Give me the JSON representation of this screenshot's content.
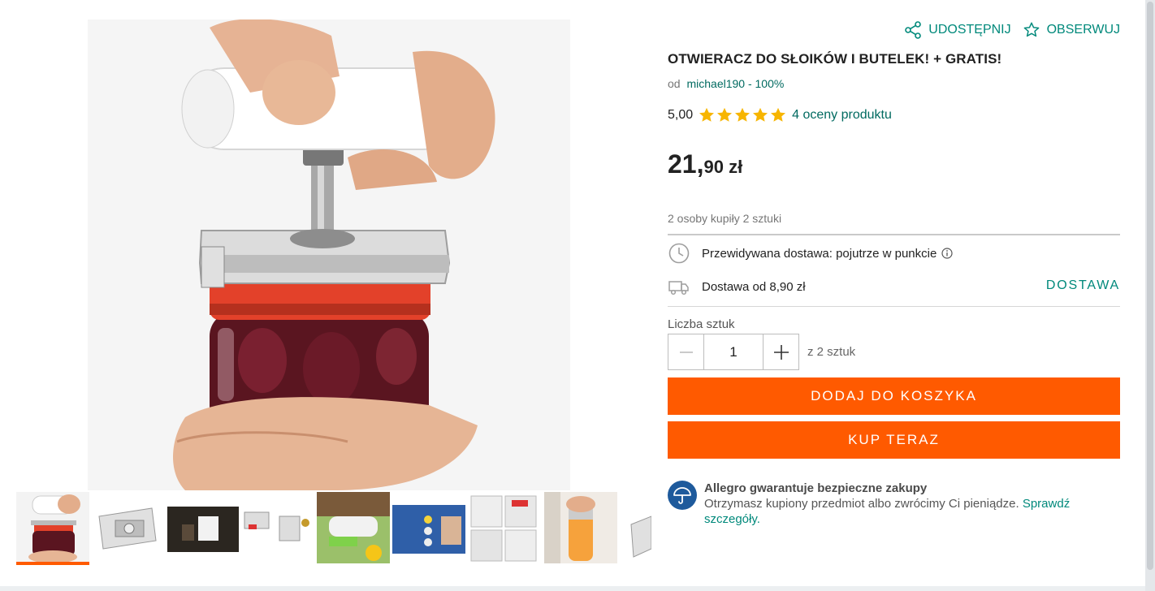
{
  "actions": {
    "share": "UDOSTĘPNIJ",
    "follow": "OBSERWUJ"
  },
  "product": {
    "title": "OTWIERACZ DO SŁOIKÓW I BUTELEK! + GRATIS!",
    "seller_prefix": "od",
    "seller": "michael190 - 100%",
    "rating_value": "5,00",
    "rating_stars": 5,
    "rating_max": 5,
    "rating_link": "4 oceny produktu",
    "price_int": "21,",
    "price_dec": "90 zł",
    "bought": "2 osoby kupiły 2 sztuki"
  },
  "delivery": {
    "expected": "Przewidywana dostawa: pojutrze w punkcie",
    "cost": "Dostawa od 8,90 zł",
    "link": "DOSTAWA"
  },
  "quantity": {
    "label": "Liczba sztuk",
    "value": "1",
    "of_text": "z 2 sztuk"
  },
  "buttons": {
    "add_to_cart": "DODAJ DO KOSZYKA",
    "buy_now": "KUP TERAZ"
  },
  "guarantee": {
    "title": "Allegro gwarantuje bezpieczne zakupy",
    "text": "Otrzymasz kupiony przedmiot albo zwrócimy Ci pieniądze.",
    "link": "Sprawdź szczegóły."
  },
  "colors": {
    "accent": "#ff5a00",
    "link": "#00897b",
    "star": "#f7b500",
    "guarantee_icon": "#1e5a9c"
  },
  "gallery": {
    "thumbnail_count": 9,
    "active_index": 0
  }
}
